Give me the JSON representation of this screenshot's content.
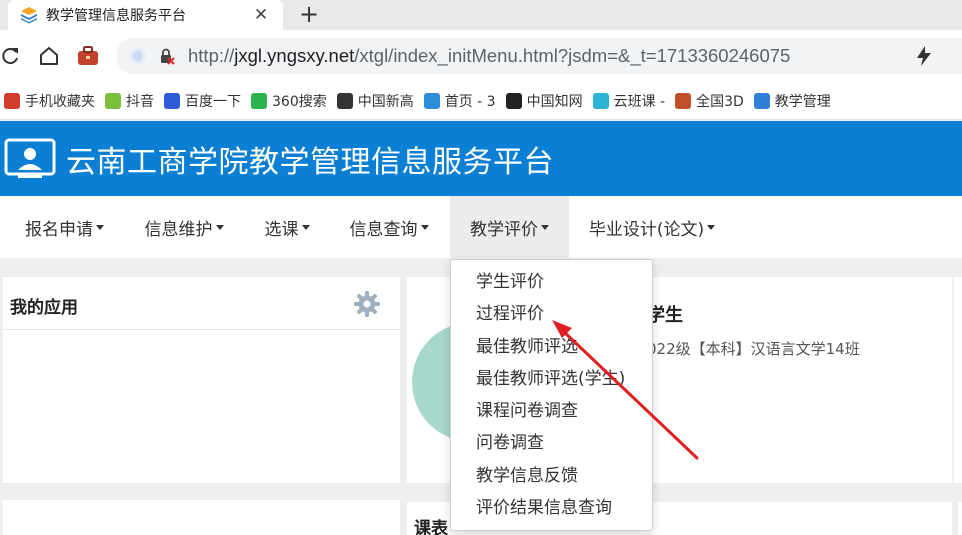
{
  "browser": {
    "tab_title": "教学管理信息服务平台",
    "close_glyph": "✕",
    "newtab_glyph": "+",
    "url_prefix": "http://",
    "url_host": "jxgl.yngsxy.net",
    "url_path": "/xtgl/index_initMenu.html?jsdm=&_t=1713360246075"
  },
  "bookmarks": [
    {
      "label": "手机收藏夹",
      "icon": "mobile-bookmark-icon",
      "color": "#d33b2c"
    },
    {
      "label": "抖音",
      "icon": "leaf-icon",
      "color": "#7cbf3a"
    },
    {
      "label": "百度一下",
      "icon": "baidu-paw-icon",
      "color": "#2f5bd6"
    },
    {
      "label": "360搜索",
      "icon": "360-ring-icon",
      "color": "#2bb24c"
    },
    {
      "label": "中国新高",
      "icon": "news-icon",
      "color": "#333333"
    },
    {
      "label": "首页 - 3",
      "icon": "pen-icon",
      "color": "#2f8fd6"
    },
    {
      "label": "中国知网",
      "icon": "cnki-icon",
      "color": "#222222"
    },
    {
      "label": "云班课 -",
      "icon": "cloud-class-icon",
      "color": "#2bb3d6"
    },
    {
      "label": "全国3D",
      "icon": "boat-icon",
      "color": "#c0502a"
    },
    {
      "label": "教学管理",
      "icon": "stack-icon",
      "color": "#2f7fd6"
    }
  ],
  "header": {
    "title": "云南工商学院教学管理信息服务平台"
  },
  "nav": [
    {
      "label": "报名申请"
    },
    {
      "label": "信息维护"
    },
    {
      "label": "选课"
    },
    {
      "label": "信息查询"
    },
    {
      "label": "教学评价"
    },
    {
      "label": "毕业设计(论文)"
    }
  ],
  "apps_panel": {
    "title": "我的应用"
  },
  "profile": {
    "name_suffix": "学生",
    "class_info": "022级【本科】汉语言文学14班"
  },
  "schedule_panel": {
    "title": "课表"
  },
  "dropdown": {
    "items": [
      "学生评价",
      "过程评价",
      "最佳教师评选",
      "最佳教师评选(学生)",
      "课程问卷调查",
      "问卷调查",
      "教学信息反馈",
      "评价结果信息查询"
    ]
  },
  "colors": {
    "header_blue": "#0a7fd3",
    "annotation_red": "#e02020",
    "avatar_teal": "#a8d8cb"
  }
}
